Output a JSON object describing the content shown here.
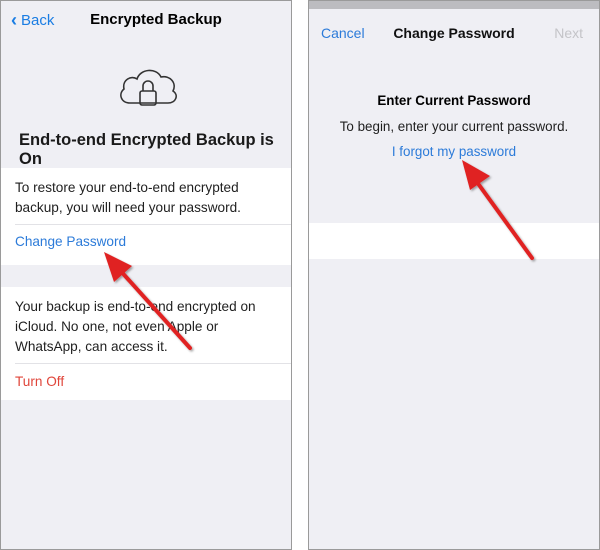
{
  "left_screen": {
    "nav": {
      "back_label": "Back",
      "title": "Encrypted Backup"
    },
    "icon": "cloud-lock-icon",
    "heading": "End-to-end Encrypted Backup is On",
    "restore_text": "To restore your end-to-end encrypted backup, you will need your password.",
    "change_password_label": "Change Password",
    "info_text": "Your backup is end-to-end encrypted on iCloud. No one, not even Apple or WhatsApp, can access it.",
    "turn_off_label": "Turn Off"
  },
  "right_screen": {
    "nav": {
      "cancel_label": "Cancel",
      "title": "Change Password",
      "next_label": "Next"
    },
    "heading": "Enter Current Password",
    "subtitle": "To begin, enter your current password.",
    "forgot_label": "I forgot my password",
    "password_value": ""
  },
  "colors": {
    "link_blue": "#2c7bd9",
    "destructive_red": "#e0453a",
    "background_gray": "#efeff4",
    "annotation_arrow": "#e02020"
  }
}
